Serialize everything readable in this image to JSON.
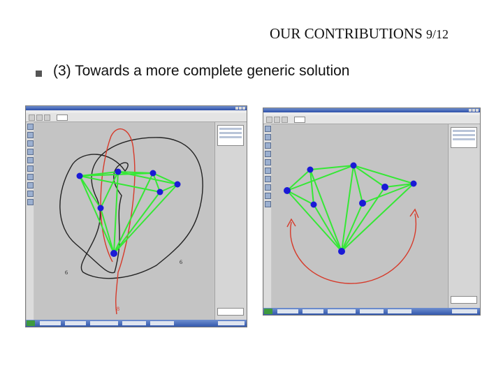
{
  "slide": {
    "title_main": "OUR CONTRIBUTIONS",
    "title_page": "9/12",
    "point_text": "(3) Towards a more complete generic solution"
  },
  "left_screenshot": {
    "label_left_curve": "6",
    "label_right_curve": "6",
    "label_red_curve": "8"
  },
  "colors": {
    "node": "#1a1ad6",
    "edge": "#35e835",
    "curve_black": "#222222",
    "curve_red": "#d63a2a",
    "canvas": "#c4c4c4"
  },
  "icons": [
    "bullet-square-icon",
    "window-close-icon",
    "tool-icon",
    "start-button-icon"
  ]
}
